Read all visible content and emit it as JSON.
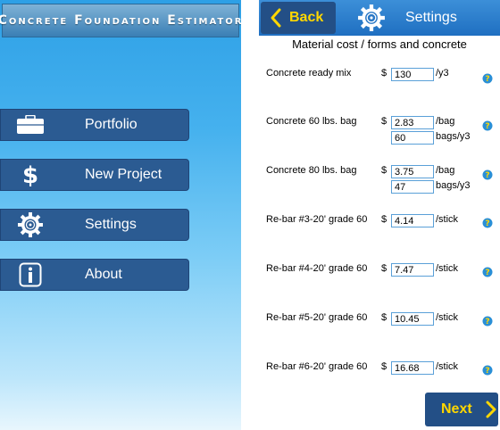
{
  "left": {
    "app_title": "Concrete Foundation Estimator",
    "menu": [
      {
        "label": "Portfolio",
        "icon": "briefcase-icon"
      },
      {
        "label": "New Project",
        "icon": "dollar-icon"
      },
      {
        "label": "Settings",
        "icon": "gear-icon"
      },
      {
        "label": "About",
        "icon": "info-icon"
      }
    ]
  },
  "right": {
    "back_label": "Back",
    "title": "Settings",
    "section_title": "Material cost / forms and concrete",
    "currency": "$",
    "rows": [
      {
        "label": "Concrete ready mix",
        "value": "130",
        "unit": "/y3"
      },
      {
        "label": "Concrete 60 lbs. bag",
        "value": "2.83",
        "unit": "/bag",
        "value2": "60",
        "unit2": "bags/y3"
      },
      {
        "label": "Concrete 80 lbs. bag",
        "value": "3.75",
        "unit": "/bag",
        "value2": "47",
        "unit2": "bags/y3"
      },
      {
        "label": "Re-bar #3-20' grade 60",
        "value": "4.14",
        "unit": "/stick"
      },
      {
        "label": "Re-bar #4-20' grade 60",
        "value": "7.47",
        "unit": "/stick"
      },
      {
        "label": "Re-bar #5-20' grade 60",
        "value": "10.45",
        "unit": "/stick"
      },
      {
        "label": "Re-bar #6-20' grade 60",
        "value": "16.68",
        "unit": "/stick"
      }
    ],
    "next_label": "Next"
  },
  "colors": {
    "nav_blue": "#234f86",
    "accent_yellow": "#ffd700",
    "input_border": "#5aa0d8",
    "help_icon": "#2a8fd6"
  }
}
